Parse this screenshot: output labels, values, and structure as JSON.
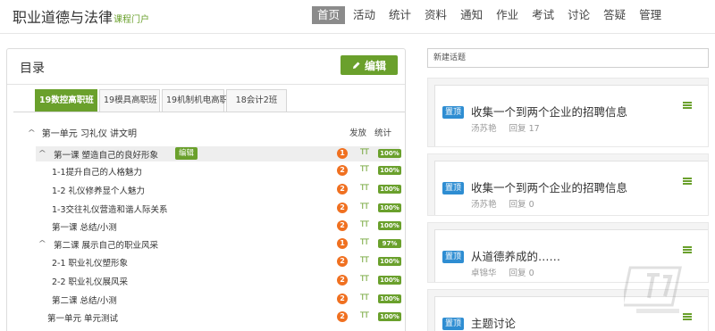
{
  "header": {
    "brand_title": "职业道德与法律",
    "brand_sub": "课程门户",
    "nav": [
      "首页",
      "活动",
      "统计",
      "资料",
      "通知",
      "作业",
      "考试",
      "讨论",
      "答疑",
      "管理"
    ],
    "active_nav": "首页"
  },
  "catalog": {
    "title": "目录",
    "edit_label": "编辑",
    "tabs": [
      "19数控高职班",
      "19模具高职班",
      "19机制机电高职",
      "18会计2班"
    ],
    "active_tab": "19数控高职班",
    "col_publish": "发放",
    "col_stats": "统计",
    "unit_label": "第一单元 习礼仪 讲文明",
    "inline_edit_label": "编辑",
    "rows": [
      {
        "label": "第一课 塑造自己的良好形象",
        "badge": "1",
        "pct": "100%"
      },
      {
        "label": "1-1提升自己的人格魅力",
        "badge": "2",
        "pct": "100%"
      },
      {
        "label": "1-2 礼仪修养显个人魅力",
        "badge": "2",
        "pct": "100%"
      },
      {
        "label": "1-3交往礼仪营造和谐人际关系",
        "badge": "2",
        "pct": "100%"
      },
      {
        "label": "第一课 总结/小测",
        "badge": "2",
        "pct": "100%"
      },
      {
        "label": "第二课 展示自己的职业风采",
        "badge": "1",
        "pct": "97%"
      },
      {
        "label": "2-1 职业礼仪塑形象",
        "badge": "2",
        "pct": "100%"
      },
      {
        "label": "2-2 职业礼仪展风采",
        "badge": "2",
        "pct": "100%"
      },
      {
        "label": "第二课 总结/小测",
        "badge": "2",
        "pct": "100%"
      },
      {
        "label": "第一单元 单元测试",
        "badge": "2",
        "pct": "100%"
      }
    ],
    "tt_glyph": "TT"
  },
  "topics": {
    "new_placeholder": "新建话题",
    "pin_label": "置顶",
    "reply_prefix": "回复",
    "items": [
      {
        "title": "收集一个到两个企业的招聘信息",
        "author": "汤苏艳",
        "replies": "17"
      },
      {
        "title": "收集一个到两个企业的招聘信息",
        "author": "汤苏艳",
        "replies": "0"
      },
      {
        "title": "从道德养成的……",
        "author": "卓锦华",
        "replies": "0"
      },
      {
        "title": "主题讨论",
        "author": "",
        "replies": ""
      }
    ]
  },
  "colors": {
    "accent_green": "#6aa02c",
    "badge_orange": "#f07020",
    "pin_blue": "#2e8dd2"
  }
}
